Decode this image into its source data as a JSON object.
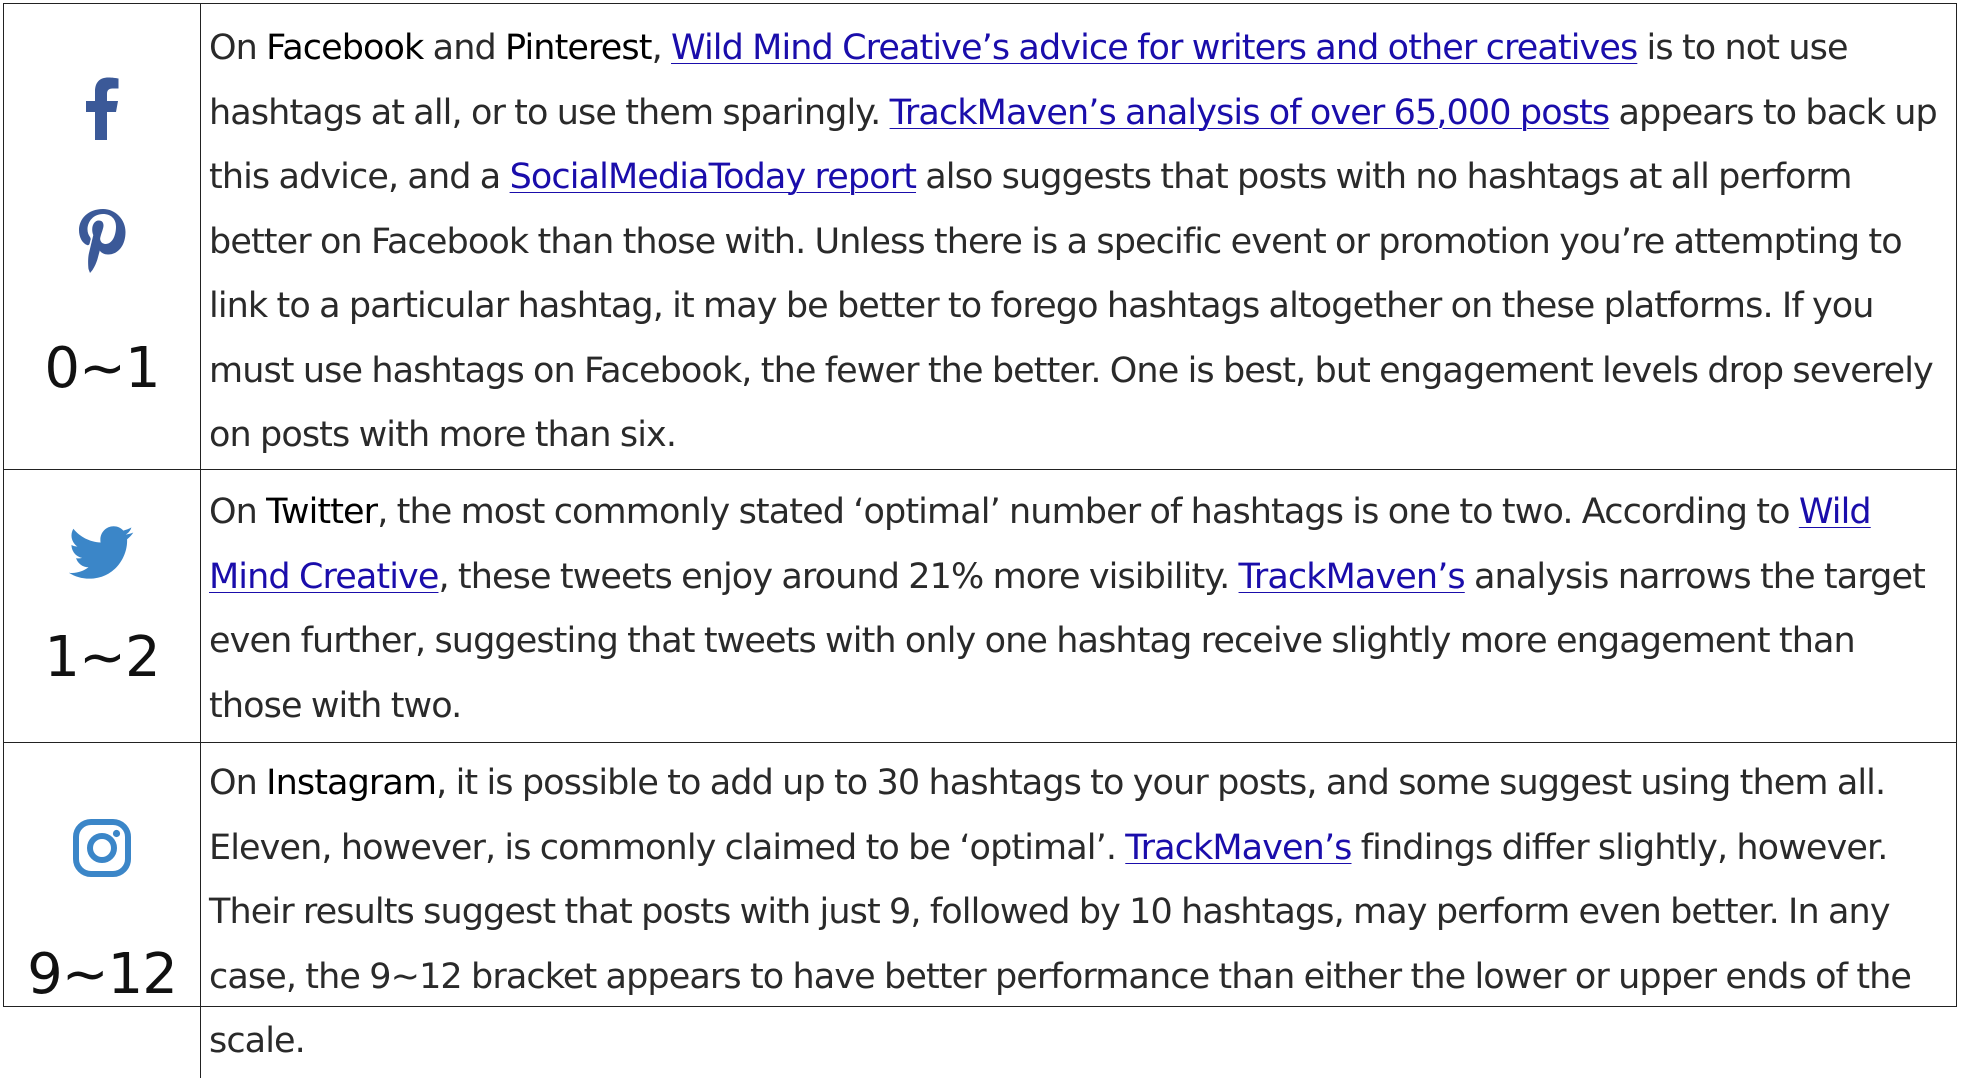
{
  "colors": {
    "facebook": "#3b5998",
    "pinterest": "#3b5998",
    "twitter": "#3b86c8",
    "instagram": "#3b86c8",
    "link": "#1a0dab",
    "border": "#222222"
  },
  "rows": [
    {
      "platform_icons": [
        "facebook-icon",
        "pinterest-icon"
      ],
      "range": "0~1",
      "text": {
        "p1": "On ",
        "b1": "Facebook",
        "p2": " and ",
        "b2": "Pinterest",
        "p3": ", ",
        "l1": "Wild Mind Creative’s advice for writers and other creatives",
        "p4": " is to not use hashtags at all, or to use them sparingly. ",
        "l2": "TrackMaven’s analysis of over 65,000 posts",
        "p5": " appears to back up this advice, and a ",
        "l3": "SocialMediaToday report",
        "p6": " also suggests that posts with no hashtags at all perform better on Facebook than those with. Unless there is a specific event or promotion you’re attempting to link to a particular hashtag, it may be better to forego hashtags altogether on these platforms. If you must use hashtags on Facebook, the fewer the better. One is best, but engagement levels drop severely on posts with more than six."
      }
    },
    {
      "platform_icons": [
        "twitter-icon"
      ],
      "range": "1~2",
      "text": {
        "p1": "On ",
        "b1": "Twitter",
        "p2": ", the most commonly stated ‘optimal’ number of hashtags is one to two. According to ",
        "l1": "Wild Mind Creative",
        "p3": ", these tweets enjoy around 21% more visibility. ",
        "l2": "TrackMaven’s",
        "p4": " analysis narrows the target even further, suggesting that tweets with only one hashtag receive slightly more engagement than those with two."
      }
    },
    {
      "platform_icons": [
        "instagram-icon"
      ],
      "range": "9~12",
      "text": {
        "p1": "On ",
        "b1": "Instagram",
        "p2": ", it is possible to add up to 30 hashtags to your posts, and some suggest using them all. Eleven, however, is commonly claimed to be ‘optimal’. ",
        "l1": "TrackMaven’s",
        "p3": " findings differ slightly, however. Their results suggest that posts with just 9, followed by 10 hashtags, may perform even better. In any case, the 9~12 bracket appears to have better performance than either the lower or upper ends of the scale."
      }
    }
  ]
}
